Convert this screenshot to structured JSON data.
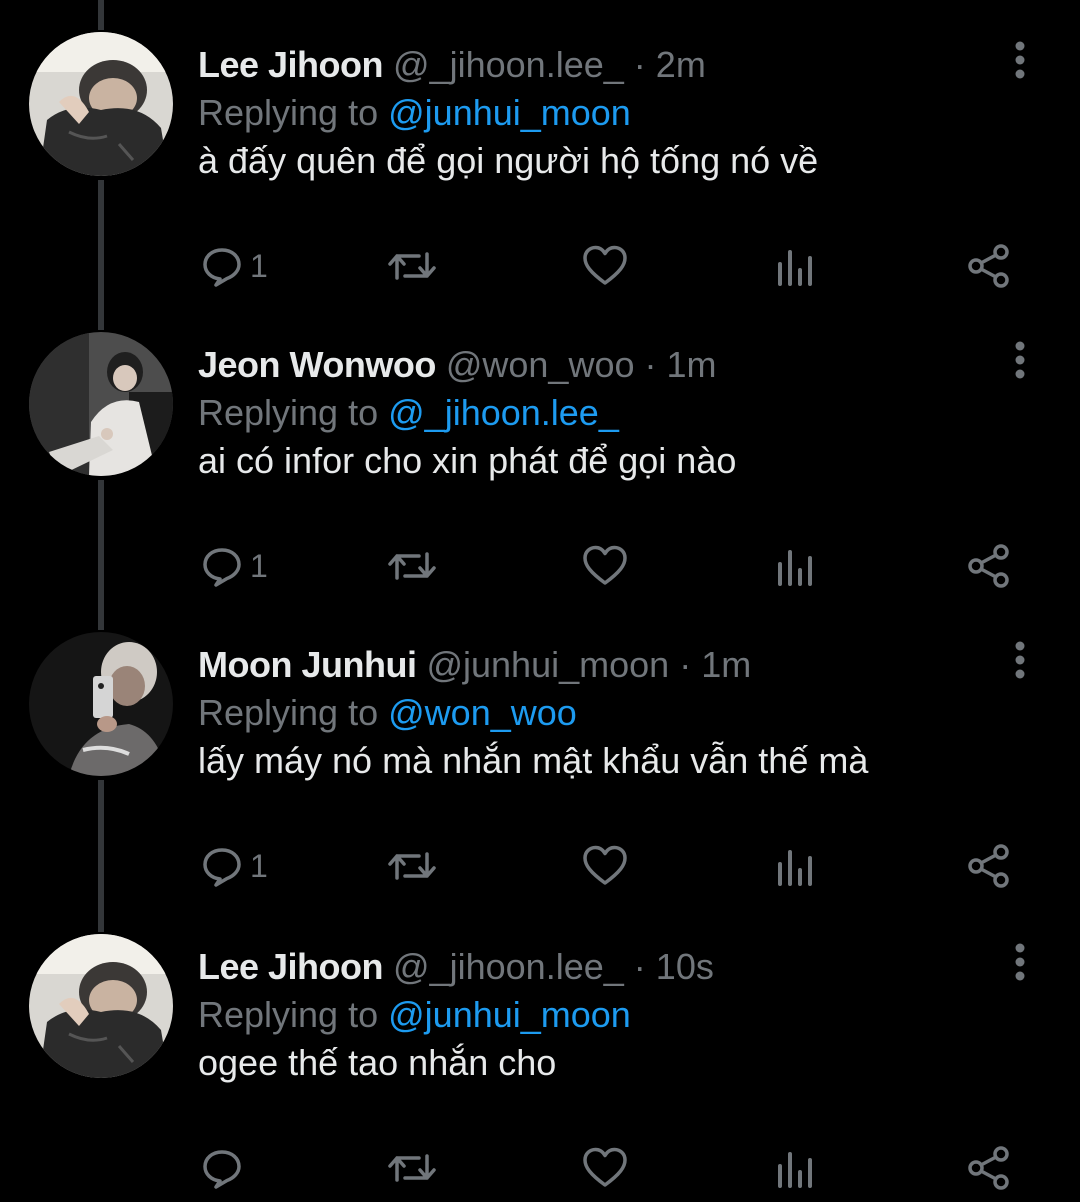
{
  "replying_prefix": "Replying to",
  "separator": "·",
  "icons": {
    "reply": "reply-bubble-icon",
    "retweet": "retweet-icon",
    "like": "heart-icon",
    "views": "views-bar-chart-icon",
    "share": "share-icon",
    "more": "more-vertical-icon"
  },
  "colors": {
    "background": "#000000",
    "text": "#e7e9ea",
    "muted": "#71767b",
    "accent": "#1d9bf0",
    "thread_line": "#333639"
  },
  "tweets": [
    {
      "name": "Lee Jihoon",
      "handle": "@_jihoon.lee_",
      "time": "2m",
      "replying_to": "@junhui_moon",
      "text": "à đấy quên để gọi người hộ tống nó về",
      "reply_count": "1"
    },
    {
      "name": "Jeon Wonwoo",
      "handle": "@won_woo",
      "time": "1m",
      "replying_to": "@_jihoon.lee_",
      "text": "ai có infor cho xin phát để gọi nào",
      "reply_count": "1"
    },
    {
      "name": "Moon Junhui",
      "handle": "@junhui_moon",
      "time": "1m",
      "replying_to": "@won_woo",
      "text": "lấy máy nó mà nhắn mật khẩu vẫn thế mà",
      "reply_count": "1"
    },
    {
      "name": "Lee Jihoon",
      "handle": "@_jihoon.lee_",
      "time": "10s",
      "replying_to": "@junhui_moon",
      "text": "ogee thế tao nhắn cho",
      "reply_count": ""
    }
  ]
}
